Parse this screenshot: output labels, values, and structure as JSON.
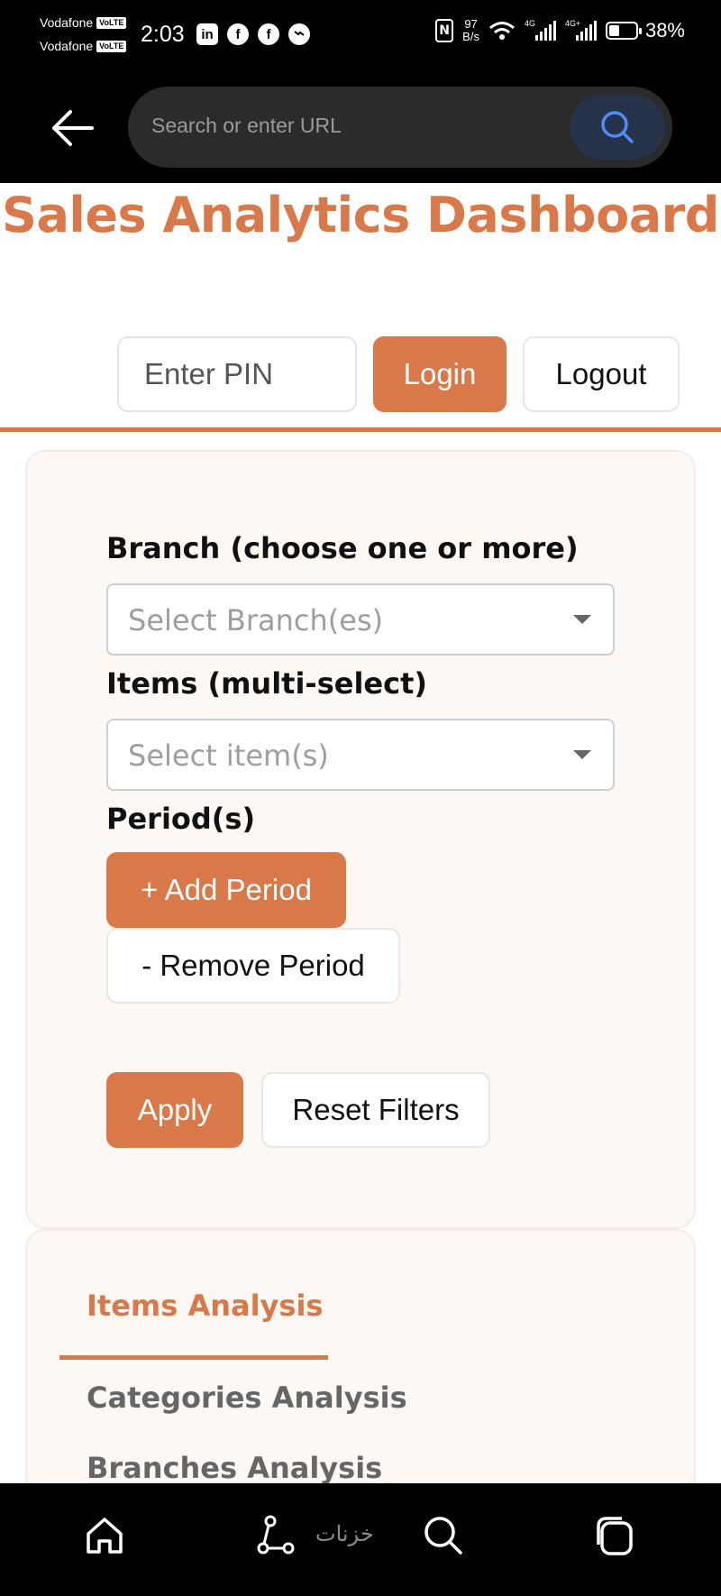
{
  "status_bar": {
    "carrier1": "Vodafone",
    "carrier2": "Vodafone",
    "volte": "VoLTE",
    "time": "2:03",
    "net_speed_value": "97",
    "net_speed_unit": "B/s",
    "sig1_tag": "4G",
    "sig2_tag": "4G+",
    "battery": "38%",
    "battery_level": 0.38,
    "app_icons": [
      "linkedin-icon",
      "facebook-icon",
      "facebook-icon",
      "messenger-icon"
    ]
  },
  "browser": {
    "url_placeholder": "Search or enter URL"
  },
  "header": {
    "title": "Sales Analytics Dashboard",
    "pin_placeholder": "Enter PIN",
    "login_label": "Login",
    "logout_label": "Logout"
  },
  "filters": {
    "branch_label": "Branch (choose one or more)",
    "branch_placeholder": "Select Branch(es)",
    "items_label": "Items (multi-select)",
    "items_placeholder": "Select item(s)",
    "period_label": "Period(s)",
    "add_period_label": "+ Add Period",
    "remove_period_label": "- Remove Period",
    "apply_label": "Apply",
    "reset_label": "Reset Filters"
  },
  "tabs": {
    "items": [
      {
        "label": "Items Analysis",
        "active": true
      },
      {
        "label": "Categories Analysis",
        "active": false
      },
      {
        "label": "Branches Analysis",
        "active": false
      }
    ]
  },
  "bottom_nav": {
    "watermark": "خزنات",
    "items": [
      "home-icon",
      "share-icon",
      "search-icon",
      "tabs-icon"
    ]
  },
  "colors": {
    "accent": "#d9794a",
    "panel_bg": "#fdf8f4"
  }
}
